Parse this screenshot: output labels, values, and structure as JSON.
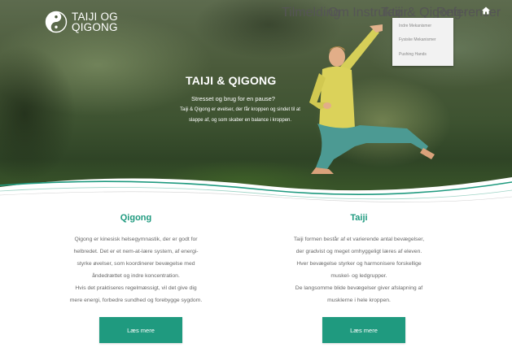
{
  "brand": {
    "line1": "TAIJI OG",
    "line2": "QIGONG"
  },
  "nav": {
    "items": [
      "Tilmelding",
      "Om Instruktør",
      "Taiji & Qigong",
      "Referencer"
    ],
    "home_icon": "home-icon",
    "dropdown": [
      "Indre Mekanismer",
      "Fysiske Mekanismer",
      "Pushing Hands"
    ]
  },
  "hero": {
    "title": "TAIJI & QIGONG",
    "subtitle": "Stresset og brug for en pause?",
    "desc_line1": "Taiji & Qigong er øvelser, der får kroppen og sindet til at",
    "desc_line2": "slappe af, og som skaber en balance i kroppen."
  },
  "qigong": {
    "title": "Qigong",
    "lines": [
      "Qigong er kinesisk helsegymnastik, der er godt for",
      "helbredet.  Det er et nem-at-lære system, af energi-",
      "styrke øvelser, som koordinerer bevægelse med",
      "åndedrættet og indre koncentration.",
      "Hvis det praktiseres regelmæssigt, vil det give dig",
      "mere energi, forbedre sundhed og forebygge sygdom."
    ],
    "button": "Læs mere"
  },
  "taiji": {
    "title": "Taiji",
    "lines": [
      "Taiji formen består af et varierende antal bevægelser,",
      "der gradvist og meget omhyggeligt læres af eleven.",
      "Hver bevægelse styrker og harmonisere forskellige",
      "muskel- og ledgrupper.",
      "De langsomme blide bevægelser giver afslapning af",
      "musklerne i hele kroppen."
    ],
    "button": "Læs mere"
  },
  "colors": {
    "accent": "#1f9a7f",
    "text": "#666666"
  }
}
